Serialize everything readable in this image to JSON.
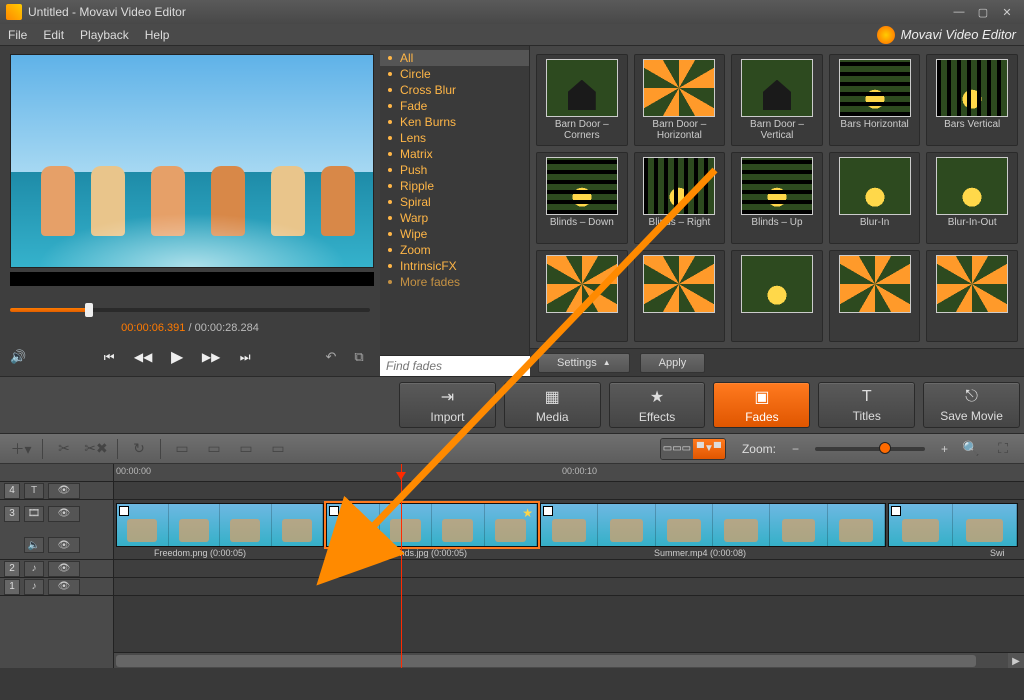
{
  "window": {
    "title": "Untitled - Movavi Video Editor"
  },
  "menu": {
    "file": "File",
    "edit": "Edit",
    "playback": "Playback",
    "help": "Help",
    "brand": "Movavi Video Editor"
  },
  "scrubber": {
    "current": "00:00:06.391",
    "total": "00:00:28.284",
    "sep": " / "
  },
  "categories": {
    "items": [
      "All",
      "Circle",
      "Cross Blur",
      "Fade",
      "Ken Burns",
      "Lens",
      "Matrix",
      "Push",
      "Ripple",
      "Spiral",
      "Warp",
      "Wipe",
      "Zoom",
      "IntrinsicFX",
      "More fades"
    ],
    "selected": 0,
    "find_placeholder": "Find fades"
  },
  "fades": {
    "row1": [
      "Barn Door – Corners",
      "Barn Door – Horizontal",
      "Barn Door – Vertical",
      "Bars Horizontal",
      "Bars Vertical"
    ],
    "row2": [
      "Blinds – Down",
      "Blinds – Right",
      "Blinds – Up",
      "Blur-In",
      "Blur-In-Out"
    ],
    "settings": "Settings",
    "apply": "Apply"
  },
  "toolbar": {
    "import": "Import",
    "media": "Media",
    "effects": "Effects",
    "fades": "Fades",
    "titles": "Titles",
    "save": "Save Movie"
  },
  "tl_toolbar": {
    "zoom_label": "Zoom:"
  },
  "timeline": {
    "ruler": {
      "t0": "00:00:00",
      "t1": "00:00:10"
    },
    "tracks": [
      "4",
      "3",
      "2",
      "1"
    ],
    "clips": {
      "c1": {
        "label": "Freedom.png (0:00:05)"
      },
      "c2": {
        "label": "Friends.jpg (0:00:05)"
      },
      "c3": {
        "label": "Summer.mp4 (0:00:08)"
      },
      "c4": {
        "label": "Swi"
      }
    }
  }
}
